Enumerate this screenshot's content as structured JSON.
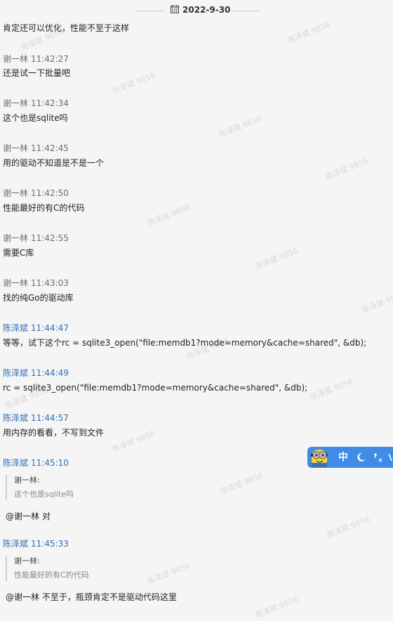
{
  "date_header": {
    "date": "2022-9-30"
  },
  "watermark": "陈泽斌 9856",
  "messages": [
    {
      "text": "肯定还可以优化，性能不至于这样"
    },
    {
      "sender": "谢一林",
      "time": "11:42:27",
      "text": "还是试一下批量吧"
    },
    {
      "sender": "谢一林",
      "time": "11:42:34",
      "text": "这个也是sqlite吗"
    },
    {
      "sender": "谢一林",
      "time": "11:42:45",
      "text": "用的驱动不知道是不是一个"
    },
    {
      "sender": "谢一林",
      "time": "11:42:50",
      "text": "性能最好的有C的代码"
    },
    {
      "sender": "谢一林",
      "time": "11:42:55",
      "text": "需要C库"
    },
    {
      "sender": "谢一林",
      "time": "11:43:03",
      "text": "找的纯Go的驱动库"
    },
    {
      "sender": "陈泽斌",
      "time": "11:44:47",
      "text": "等等，试下这个rc = sqlite3_open(\"file:memdb1?mode=memory&cache=shared\", &db);"
    },
    {
      "sender": "陈泽斌",
      "time": "11:44:49",
      "text": "rc = sqlite3_open(\"file:memdb1?mode=memory&cache=shared\", &db);"
    },
    {
      "sender": "陈泽斌",
      "time": "11:44:57",
      "text": "用内存的看看，不写到文件"
    },
    {
      "sender": "陈泽斌",
      "time": "11:45:10",
      "quote_author": "谢一林:",
      "quote_text": "这个也是sqlite吗",
      "text": "@谢一林   对"
    },
    {
      "sender": "陈泽斌",
      "time": "11:45:33",
      "quote_author": "谢一林:",
      "quote_text": "性能最好的有C的代码",
      "text": "@谢一林  不至于，瓶颈肯定不是驱动代码这里"
    }
  ],
  "ime_toolbar": {
    "mode": "中",
    "items": [
      "中",
      "moon-icon",
      "punctuation-icon",
      "more"
    ],
    "color": "#3f8be6"
  }
}
